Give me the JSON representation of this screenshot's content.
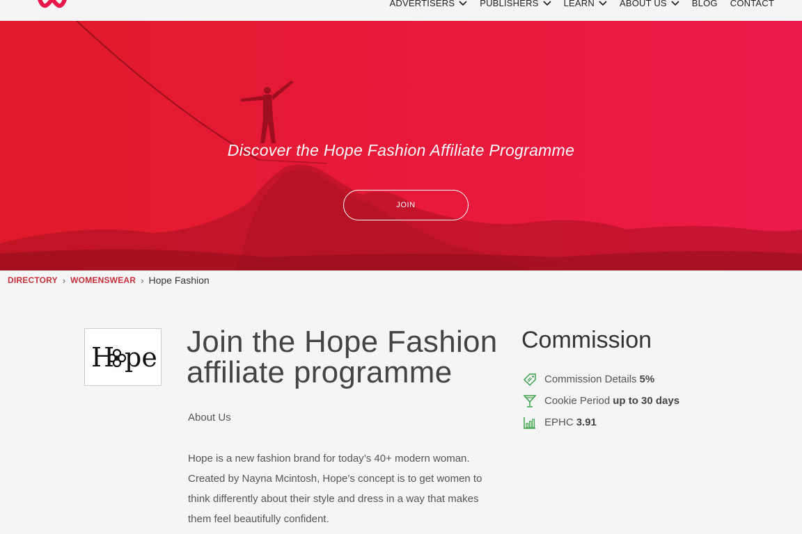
{
  "header": {
    "logo_icon": "brand-w-logo",
    "brand_color": "#e8194a",
    "nav": [
      {
        "label": "ADVERTISERS",
        "has_dropdown": true
      },
      {
        "label": "PUBLISHERS",
        "has_dropdown": true
      },
      {
        "label": "LEARN",
        "has_dropdown": true
      },
      {
        "label": "ABOUT US",
        "has_dropdown": true
      },
      {
        "label": "BLOG",
        "has_dropdown": false
      },
      {
        "label": "CONTACT",
        "has_dropdown": false
      }
    ]
  },
  "hero": {
    "title": "Discover the Hope Fashion Affiliate Programme",
    "join_label": "JOIN",
    "background_color": "#e8193a"
  },
  "breadcrumb": {
    "items": [
      "DIRECTORY",
      "WOMENSWEAR"
    ],
    "separator": "›",
    "current": "Hope Fashion"
  },
  "brand": {
    "logo_text": "Hope",
    "logo_icon": "flower-icon"
  },
  "main": {
    "heading": "Join the Hope Fashion affiliate programme",
    "about_title": "About Us",
    "about_body": "Hope is a new fashion brand for today’s 40+ modern woman. Created by Nayna Mcintosh, Hope’s concept is to get women to think differently about their style and dress in a way that makes them feel beautifully confident."
  },
  "commission": {
    "title": "Commission",
    "icon_color": "#3aa14a",
    "rows": [
      {
        "icon": "tag-icon",
        "label": "Commission Details",
        "value": "5%"
      },
      {
        "icon": "cookie-glass-icon",
        "label": "Cookie Period",
        "value": "up to 30 days"
      },
      {
        "icon": "bar-chart-icon",
        "label": "EPHC",
        "value": "3.91"
      }
    ]
  }
}
